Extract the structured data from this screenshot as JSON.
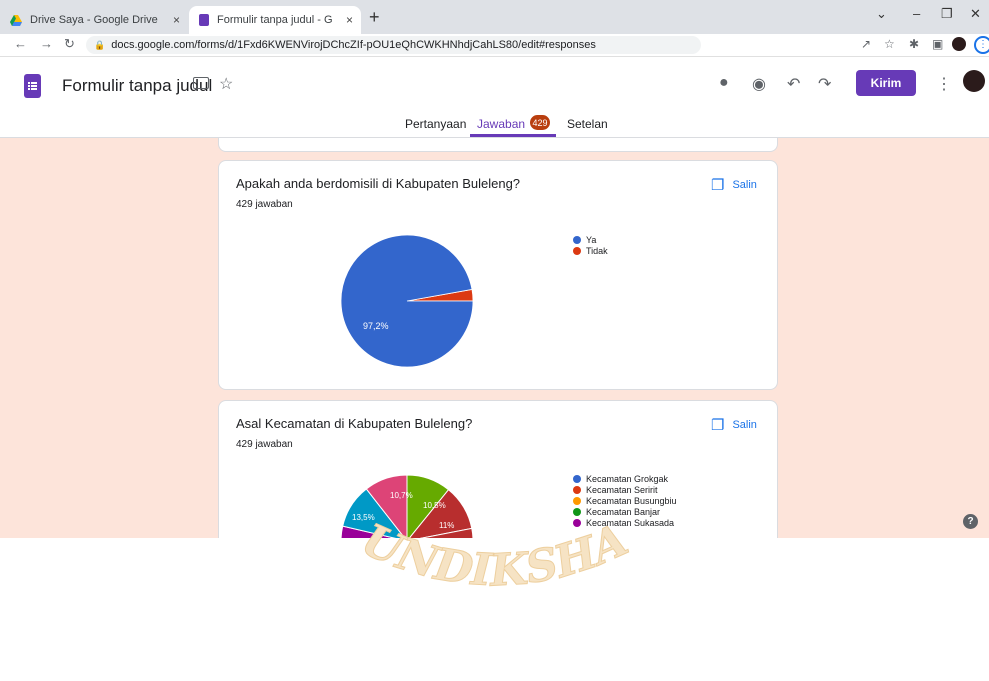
{
  "browser": {
    "tabs": [
      {
        "title": "Drive Saya - Google Drive",
        "close": "×"
      },
      {
        "title": "Formulir tanpa judul - Google Fo",
        "close": "×"
      }
    ],
    "new_tab": "+",
    "url": "docs.google.com/forms/d/1Fxd6KWENVirojDChcZIf-pOU1eQhCWKHNhdjCahLS80/edit#responses"
  },
  "form": {
    "title": "Formulir tanpa judul",
    "send_label": "Kirim",
    "tabs": [
      {
        "label": "Pertanyaan"
      },
      {
        "label": "Jawaban",
        "badge": "429"
      },
      {
        "label": "Setelan"
      }
    ]
  },
  "questions": [
    {
      "title": "Apakah anda berdomisili di Kabupaten Buleleng?",
      "count": "429 jawaban",
      "copy_label": "Salin"
    },
    {
      "title": "Asal Kecamatan di Kabupaten Buleleng?",
      "count": "429 jawaban",
      "copy_label": "Salin"
    }
  ],
  "chart_data": [
    {
      "type": "pie",
      "categories": [
        "Ya",
        "Tidak"
      ],
      "values": [
        97.2,
        2.8
      ],
      "labels": [
        "97,2%",
        ""
      ],
      "colors": [
        "#3366cc",
        "#dc3912"
      ]
    },
    {
      "type": "pie",
      "categories": [
        "Kecamatan Grokgak",
        "Kecamatan Seririt",
        "Kecamatan Busungbiu",
        "Kecamatan Banjar",
        "Kecamatan Sukasada"
      ],
      "visible_slice_labels": [
        "10,7%",
        "10,5%",
        "13,5%",
        "11%"
      ],
      "colors": [
        "#3366cc",
        "#dc3912",
        "#ff9900",
        "#109618",
        "#990099",
        "#0099c6",
        "#dd4477",
        "#66aa00",
        "#b82e2e"
      ]
    }
  ],
  "watermark": "UNDIKSHA"
}
